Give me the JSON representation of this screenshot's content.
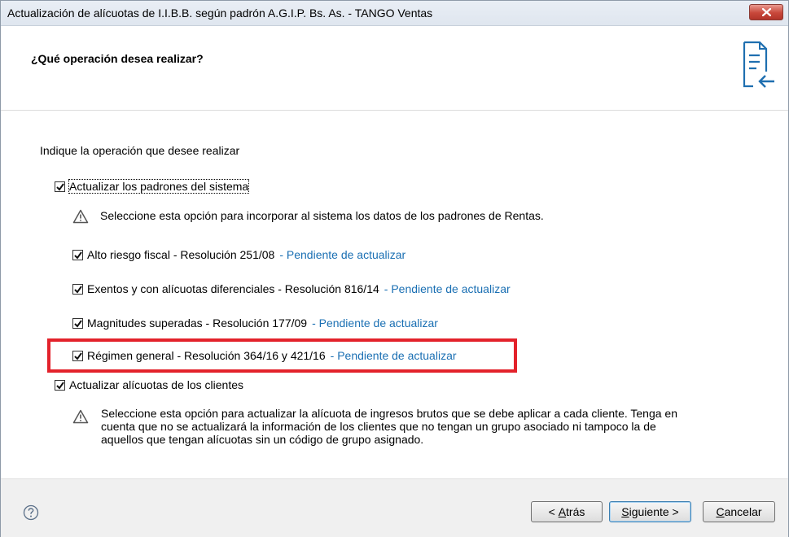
{
  "window": {
    "title": "Actualización de alícuotas de I.I.B.B. según padrón A.G.I.P. Bs. As. - TANGO Ventas"
  },
  "header": {
    "title": "¿Qué operación desea realizar?"
  },
  "content": {
    "instruction": "Indique la operación que desee realizar",
    "update_padrones": {
      "label": "Actualizar los padrones del sistema",
      "checked": true,
      "note": "Seleccione esta opción para incorporar al sistema los datos de los padrones de Rentas.",
      "items": [
        {
          "label": "Alto riesgo fiscal - Resolución 251/08",
          "status": "- Pendiente de actualizar",
          "checked": true
        },
        {
          "label": "Exentos y con alícuotas diferenciales - Resolución 816/14",
          "status": "- Pendiente de actualizar",
          "checked": true
        },
        {
          "label": "Magnitudes superadas - Resolución 177/09",
          "status": "- Pendiente de actualizar",
          "checked": true
        },
        {
          "label": "Régimen general - Resolución 364/16 y 421/16",
          "status": "- Pendiente de actualizar",
          "checked": true
        }
      ]
    },
    "update_clients": {
      "label": "Actualizar alícuotas de los clientes",
      "checked": true,
      "note_lines": [
        "Seleccione esta opción para actualizar la alícuota de ingresos brutos que se debe aplicar a cada cliente. Tenga en",
        "cuenta que no se actualizará la información de los clientes que no tengan un grupo asociado ni tampoco la de",
        "aquellos que tengan alícuotas sin un código de grupo asignado."
      ]
    }
  },
  "footer": {
    "back": {
      "prefix": "< ",
      "hotkey": "A",
      "rest": "trás"
    },
    "next": {
      "hotkey": "S",
      "rest": "iguiente >"
    },
    "cancel": {
      "hotkey": "C",
      "rest": "ancelar"
    }
  },
  "colors": {
    "status_link": "#1a6fb3",
    "highlight": "#e3222b"
  }
}
